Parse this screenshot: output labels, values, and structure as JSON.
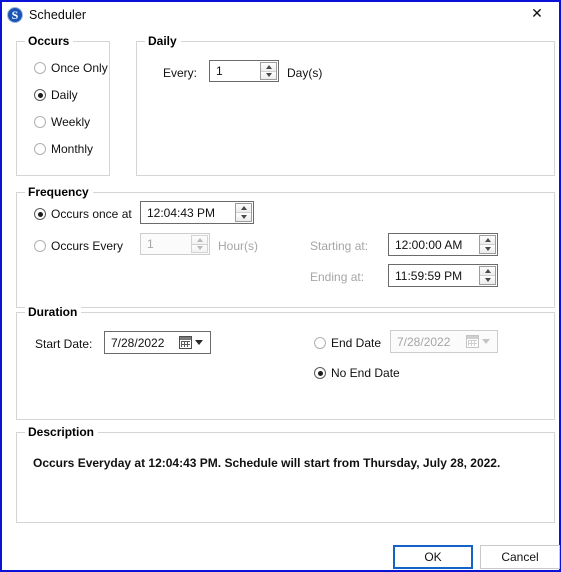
{
  "window": {
    "title": "Scheduler",
    "icon": "scheduler-app-icon",
    "close_icon": "✕",
    "border_color": "#0A12D8"
  },
  "occurs": {
    "legend": "Occurs",
    "selected": "Daily",
    "options": [
      {
        "label": "Once Only",
        "checked": false
      },
      {
        "label": "Daily",
        "checked": true
      },
      {
        "label": "Weekly",
        "checked": false
      },
      {
        "label": "Monthly",
        "checked": false
      }
    ]
  },
  "daily": {
    "legend": "Daily",
    "every_label": "Every:",
    "every_value": "1",
    "unit_label": "Day(s)"
  },
  "frequency": {
    "legend": "Frequency",
    "once_at": {
      "label": "Occurs once at",
      "checked": true,
      "value": "12:04:43 PM"
    },
    "every": {
      "label": "Occurs Every",
      "checked": false,
      "value": "1",
      "unit_label": "Hour(s)",
      "disabled": true
    },
    "starting_at": {
      "label": "Starting at:",
      "value": "12:00:00 AM"
    },
    "ending_at": {
      "label": "Ending at:",
      "value": "11:59:59 PM"
    }
  },
  "duration": {
    "legend": "Duration",
    "start_date": {
      "label": "Start Date:",
      "value": "7/28/2022"
    },
    "end_date": {
      "label": "End Date",
      "checked": false,
      "value": "7/28/2022",
      "disabled": true
    },
    "no_end_date": {
      "label": "No End Date",
      "checked": true
    }
  },
  "description": {
    "legend": "Description",
    "text": "Occurs Everyday at 12:04:43 PM. Schedule will start from Thursday, July 28, 2022."
  },
  "footer": {
    "ok_label": "OK",
    "cancel_label": "Cancel"
  }
}
